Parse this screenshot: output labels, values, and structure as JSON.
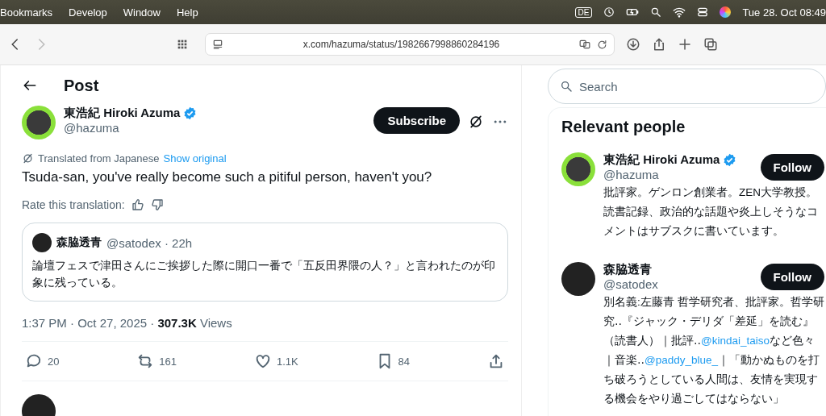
{
  "menu_bar": {
    "items": [
      "Bookmarks",
      "Develop",
      "Window",
      "Help"
    ],
    "input_badge": "DE",
    "clock": "Tue 28. Oct 08:49"
  },
  "browser": {
    "nav": [
      {
        "kind": "back",
        "disabled": false
      },
      {
        "kind": "forward",
        "disabled": true
      }
    ],
    "url": "x.com/hazuma/status/1982667998860284196"
  },
  "post": {
    "header": "Post",
    "author": {
      "name": "東浩紀 Hiroki Azuma",
      "verified": true,
      "handle": "@hazuma"
    },
    "subscribe": "Subscribe",
    "translation": {
      "label": "Translated from Japanese",
      "link": "Show original"
    },
    "text": "Tsuda-san, you've really become such a pitiful person, haven't you?",
    "rate_label": "Rate this translation:",
    "quote": {
      "name": "森脇透青",
      "handle_time": "@satodex · 22h",
      "text": "論壇フェスで津田さんにご挨拶した際に開口一番で「五反田界隈の人？」と言われたのが印象に残っている。"
    },
    "meta": "1:37 PM · Oct 27, 2025 · **307.3K** Views",
    "actions": [
      {
        "kind": "reply",
        "count": "20"
      },
      {
        "kind": "repost",
        "count": "161"
      },
      {
        "kind": "like",
        "count": "1.1K"
      },
      {
        "kind": "bookmark",
        "count": "84"
      },
      {
        "kind": "share"
      }
    ]
  },
  "sidebar": {
    "search": {
      "placeholder": "Search"
    },
    "relevant": {
      "title": "Relevant people",
      "people": [
        {
          "name": "東浩紀 Hiroki Azuma",
          "verified": true,
          "handle": "@hazuma",
          "follow": "Follow",
          "bio": [
            {
              "kind": "text",
              "text": "批評家。ゲンロン創業者。ZEN大学教授。読書記録、政治的な話題や炎上しそうなコメントはサブスクに書いています。"
            }
          ]
        },
        {
          "name": "森脇透青",
          "verified": false,
          "handle": "@satodex",
          "follow": "Follow",
          "bio": [
            {
              "kind": "text",
              "text": "別名義:左藤青 哲学研究者、批評家。哲学研究‥『ジャック・デリダ「差延」を読む』（読書人）｜批評‥"
            },
            {
              "kind": "link",
              "text": "@kindai_taiso"
            },
            {
              "kind": "text",
              "text": "など色々｜音楽‥"
            },
            {
              "kind": "link",
              "text": "@paddy_blue_"
            },
            {
              "kind": "text",
              "text": "｜「動かぬものを打ち破ろうとしている人間は、友情を実現する機会をやり過ごしてはならない」"
            }
          ]
        }
      ]
    }
  }
}
